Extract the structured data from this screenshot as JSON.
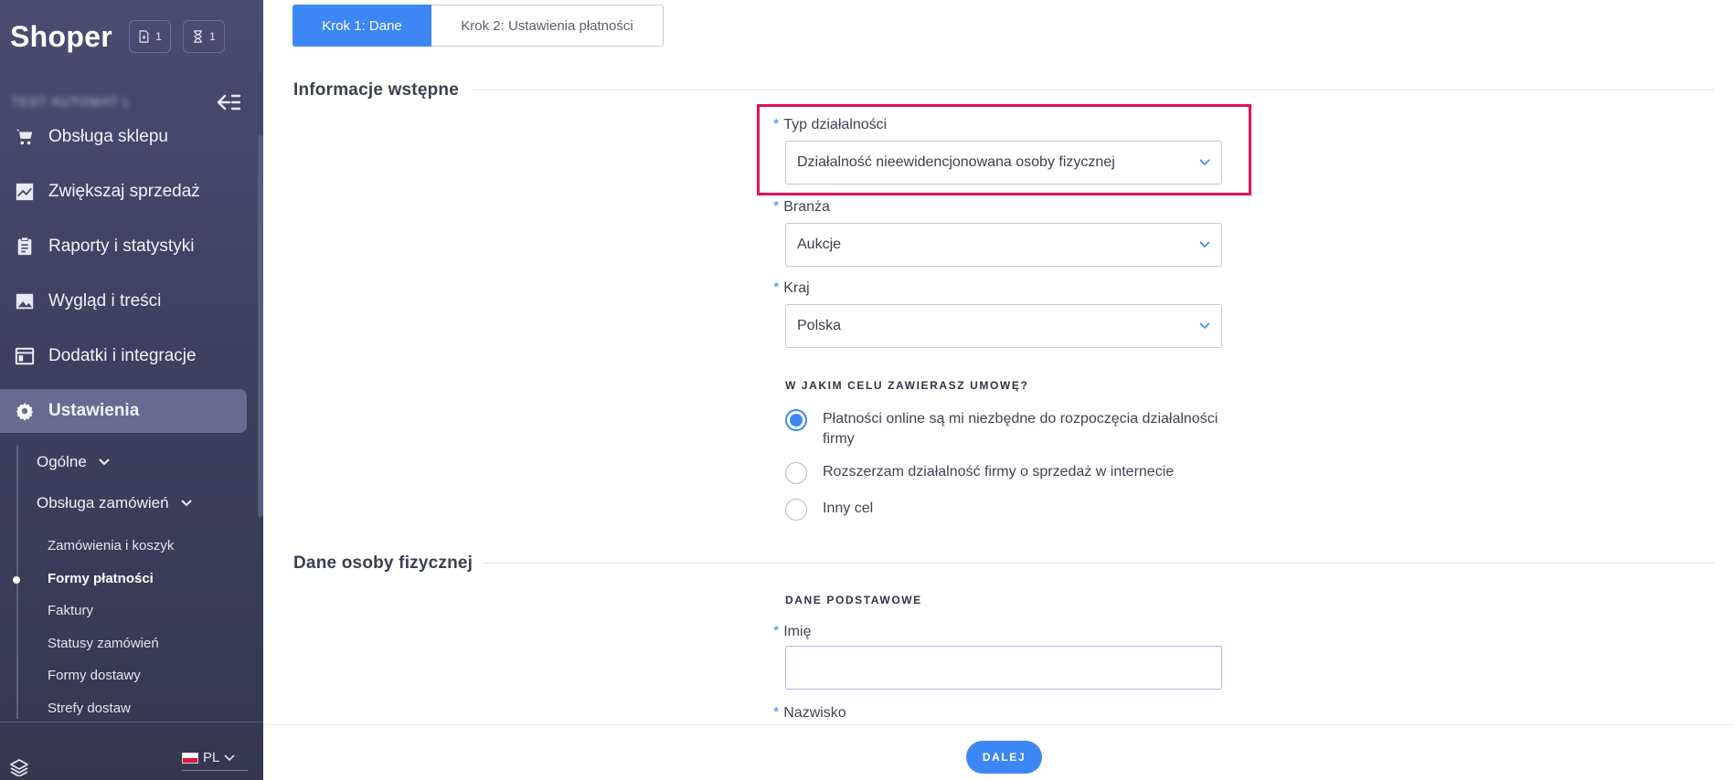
{
  "app": {
    "logo": "Shoper",
    "blurred_store_name": "TEST AUTOMAT L"
  },
  "topbar": {
    "badges": [
      {
        "icon": "document-icon",
        "count": "1"
      },
      {
        "icon": "hourglass-icon",
        "count": "1"
      }
    ]
  },
  "sidebar": {
    "items": [
      {
        "label": "Obsługa sklepu",
        "icon": "cart-icon"
      },
      {
        "label": "Zwiększaj sprzedaż",
        "icon": "trending-icon"
      },
      {
        "label": "Raporty i statystyki",
        "icon": "clipboard-icon"
      },
      {
        "label": "Wygląd i treści",
        "icon": "image-icon"
      },
      {
        "label": "Dodatki i integracje",
        "icon": "window-icon"
      },
      {
        "label": "Ustawienia",
        "icon": "gear-icon",
        "active": true
      }
    ],
    "groups": [
      {
        "label": "Ogólne"
      },
      {
        "label": "Obsługa zamówień"
      }
    ],
    "subitems": [
      {
        "label": "Zamówienia i koszyk"
      },
      {
        "label": "Formy płatności",
        "current": true
      },
      {
        "label": "Faktury"
      },
      {
        "label": "Statusy zamówień"
      },
      {
        "label": "Formy dostawy"
      },
      {
        "label": "Strefy dostaw"
      }
    ],
    "language": "PL"
  },
  "tabs": [
    {
      "label": "Krok 1: Dane",
      "active": true
    },
    {
      "label": "Krok 2: Ustawienia płatności",
      "active": false
    }
  ],
  "sections": {
    "intro_title": "Informacje wstępne",
    "person_title": "Dane osoby fizycznej"
  },
  "form": {
    "business_type": {
      "label": "Typ działalności",
      "value": "Działalność nieewidencjonowana osoby fizycznej"
    },
    "industry": {
      "label": "Branża",
      "value": "Aukcje"
    },
    "country": {
      "label": "Kraj",
      "value": "Polska"
    },
    "purpose": {
      "heading": "W JAKIM CELU ZAWIERASZ UMOWĘ?",
      "options": [
        {
          "label": "Płatności online są mi niezbędne do rozpoczęcia działalności firmy",
          "checked": true
        },
        {
          "label": "Rozszerzam działalność firmy o sprzedaż w internecie",
          "checked": false
        },
        {
          "label": "Inny cel",
          "checked": false
        }
      ]
    },
    "basic_heading": "DANE PODSTAWOWE",
    "first_name": {
      "label": "Imię",
      "value": ""
    },
    "last_name": {
      "label": "Nazwisko"
    },
    "required_marker": "*"
  },
  "footer": {
    "next_label": "DALEJ"
  },
  "colors": {
    "accent": "#3d87f5",
    "highlight": "#e3105f",
    "sidebar": "#45466a"
  }
}
